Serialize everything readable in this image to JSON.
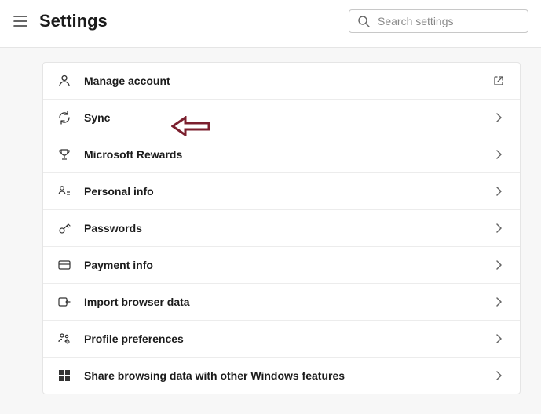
{
  "header": {
    "title": "Settings",
    "search_placeholder": "Search settings"
  },
  "rows": [
    {
      "id": "manage-account",
      "icon": "person-icon",
      "label": "Manage account",
      "trail": "external"
    },
    {
      "id": "sync",
      "icon": "sync-icon",
      "label": "Sync",
      "trail": "chevron"
    },
    {
      "id": "microsoft-rewards",
      "icon": "trophy-icon",
      "label": "Microsoft Rewards",
      "trail": "chevron"
    },
    {
      "id": "personal-info",
      "icon": "person-list-icon",
      "label": "Personal info",
      "trail": "chevron"
    },
    {
      "id": "passwords",
      "icon": "key-icon",
      "label": "Passwords",
      "trail": "chevron"
    },
    {
      "id": "payment-info",
      "icon": "card-icon",
      "label": "Payment info",
      "trail": "chevron"
    },
    {
      "id": "import-browser-data",
      "icon": "import-icon",
      "label": "Import browser data",
      "trail": "chevron"
    },
    {
      "id": "profile-preferences",
      "icon": "people-gear-icon",
      "label": "Profile preferences",
      "trail": "chevron"
    },
    {
      "id": "share-windows",
      "icon": "windows-icon",
      "label": "Share browsing data with other Windows features",
      "trail": "chevron"
    }
  ],
  "annotation": {
    "color": "#7b1f2e"
  }
}
